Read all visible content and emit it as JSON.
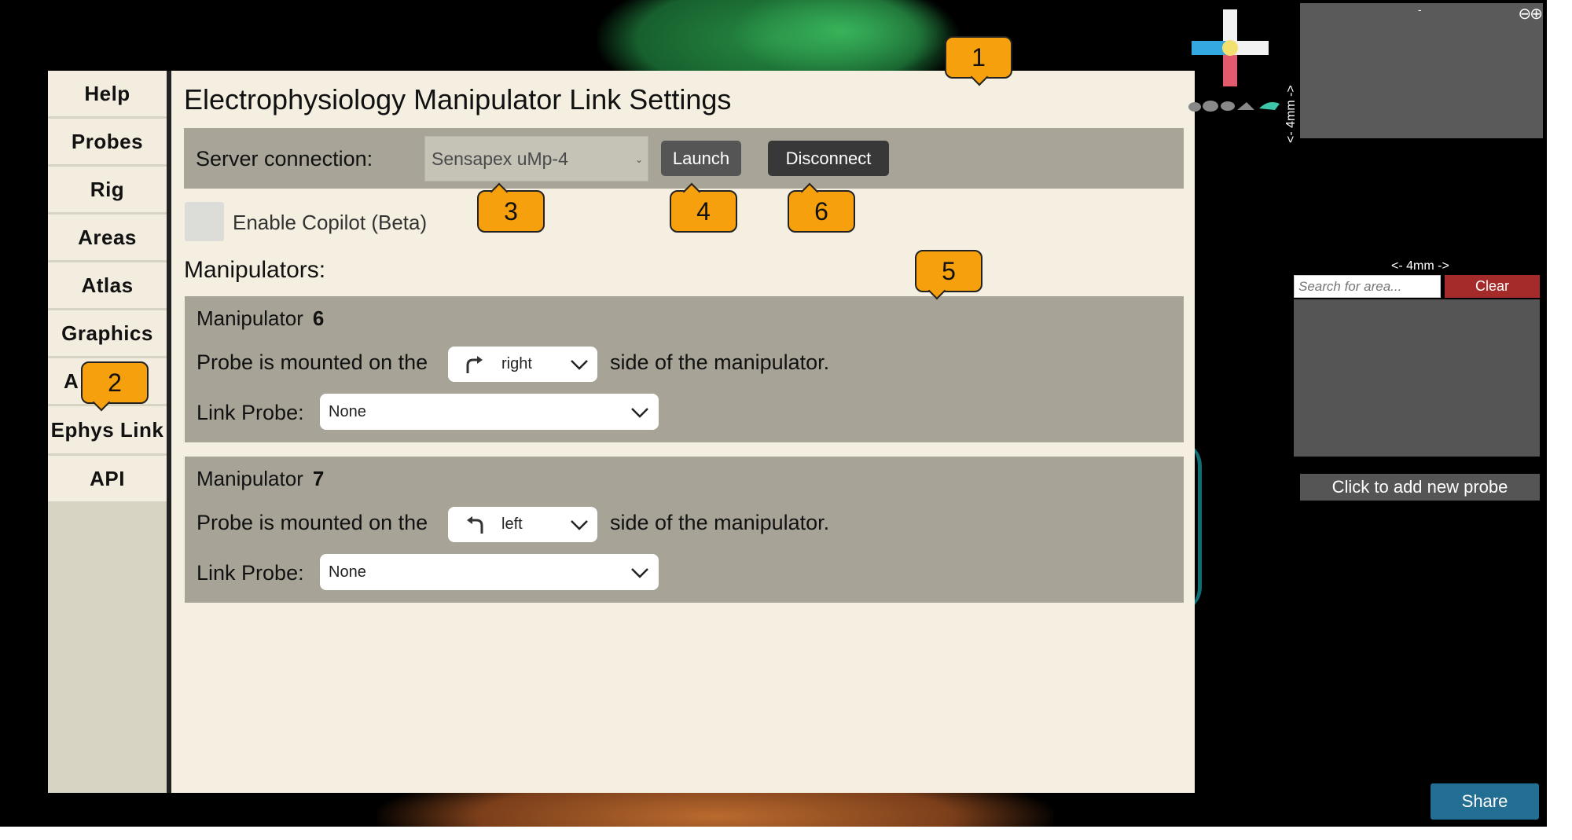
{
  "sidebar": {
    "items": [
      {
        "label": "Help"
      },
      {
        "label": "Probes"
      },
      {
        "label": "Rig"
      },
      {
        "label": "Areas"
      },
      {
        "label": "Atlas"
      },
      {
        "label": "Graphics"
      },
      {
        "label": "A"
      },
      {
        "label": "Ephys Link"
      },
      {
        "label": "API"
      }
    ]
  },
  "panel": {
    "title": "Electrophysiology Manipulator Link Settings",
    "server_label": "Server connection:",
    "server_select_value": "Sensapex uMp-4",
    "launch_label": "Launch",
    "disconnect_label": "Disconnect",
    "copilot_label": "Enable Copilot (Beta)",
    "manipulators_heading": "Manipulators:",
    "manipulators": [
      {
        "title": "Manipulator",
        "id": "6",
        "mount_prefix": "Probe is mounted on the",
        "mount_side": "right",
        "mount_suffix": "side of the manipulator.",
        "link_label": "Link Probe:",
        "link_value": "None"
      },
      {
        "title": "Manipulator",
        "id": "7",
        "mount_prefix": "Probe is mounted on the",
        "mount_side": "left",
        "mount_suffix": "side of the manipulator.",
        "link_label": "Link Probe:",
        "link_value": "None"
      }
    ]
  },
  "callouts": [
    "1",
    "2",
    "3",
    "4",
    "5",
    "6"
  ],
  "right": {
    "top_view_dash": "-",
    "scale_vertical": "<- 4mm ->",
    "scale_horizontal": "<- 4mm ->",
    "search_placeholder": "Search for area...",
    "clear_label": "Clear",
    "add_probe_label": "Click to add new probe",
    "share_label": "Share"
  },
  "colors": {
    "callout": "#f5a00c",
    "clear_button": "#a52a2a",
    "share_button": "#236e93"
  }
}
